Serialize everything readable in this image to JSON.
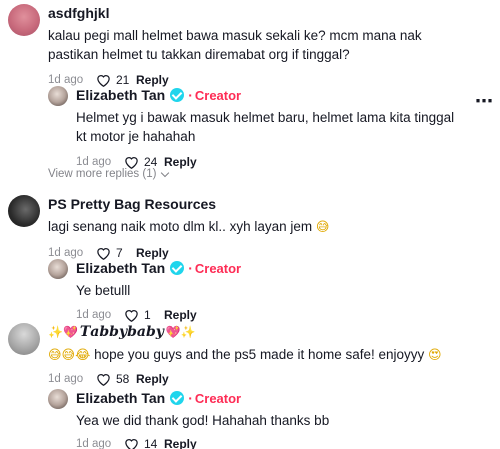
{
  "comments": [
    {
      "username": "asdfghjkl",
      "text": "kalau pegi mall helmet bawa masuk sekali ke? mcm mana nak pastikan helmet tu takkan diremabat org if tinggal?",
      "time": "1d ago",
      "likes": "21",
      "reply_label": "Reply"
    },
    {
      "username": "Elizabeth Tan",
      "badge": "Creator",
      "separator": "·",
      "text": "Helmet yg i bawak masuk helmet baru, helmet lama kita tinggal kt motor je hahahah",
      "time": "1d ago",
      "likes": "24",
      "reply_label": "Reply"
    },
    {
      "username": "PS Pretty Bag Resources",
      "text": "lagi senang naik moto dlm kl.. xyh layan jem",
      "emoji": "😅",
      "time": "1d ago",
      "likes": "7",
      "reply_label": "Reply"
    },
    {
      "username": "Elizabeth Tan",
      "badge": "Creator",
      "separator": "·",
      "text": "Ye betulll",
      "time": "1d ago",
      "likes": "1",
      "reply_label": "Reply"
    },
    {
      "username_prefix": "✨💖",
      "username": "𝑻𝒂𝒃𝒃𝒚𝒃𝒂𝒃𝒚",
      "username_suffix": "💖✨",
      "emoji_prefix": "😅😅😂",
      "text": "hope you guys and the ps5 made it home safe! enjoyyy",
      "emoji": "😍",
      "time": "1d ago",
      "likes": "58",
      "reply_label": "Reply"
    },
    {
      "username": "Elizabeth Tan",
      "badge": "Creator",
      "separator": "·",
      "text": "Yea we did thank god! Hahahah thanks bb",
      "time": "1d ago",
      "likes": "14",
      "reply_label": "Reply"
    }
  ],
  "view_more": "View more replies (1)",
  "more_icon": "⋯",
  "colors": {
    "creator": "#fe2c55",
    "verified": "#20d5ec",
    "text": "#161823",
    "muted": "#8a8b91"
  }
}
